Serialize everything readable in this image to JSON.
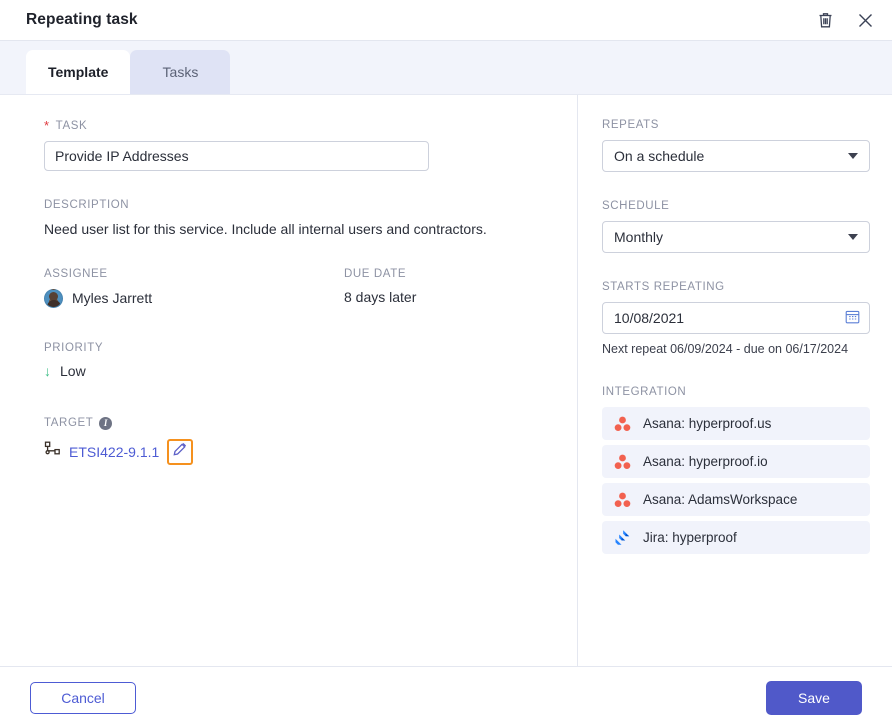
{
  "header": {
    "title": "Repeating task",
    "delete_icon": "trash-icon",
    "close_icon": "close-icon"
  },
  "tabs": [
    {
      "label": "Template",
      "active": true
    },
    {
      "label": "Tasks",
      "active": false
    }
  ],
  "form": {
    "task": {
      "label": "TASK",
      "required_marker": "*",
      "value": "Provide IP Addresses"
    },
    "description": {
      "label": "DESCRIPTION",
      "value": "Need user list for this service. Include all internal users and contractors."
    },
    "assignee": {
      "label": "ASSIGNEE",
      "value": "Myles Jarrett",
      "avatar_icon": "avatar"
    },
    "due_date": {
      "label": "DUE DATE",
      "value": "8 days later"
    },
    "priority": {
      "label": "PRIORITY",
      "value": "Low",
      "arrow_glyph": "↓",
      "arrow_color": "#3fbf87"
    },
    "target": {
      "label": "TARGET",
      "info_glyph": "i",
      "link_text": "ETSI422-9.1.1",
      "link_color": "#4d5bd4",
      "hierarchy_icon": "sitemap-icon",
      "edit_icon": "pencil-icon",
      "focus_color": "#f5911e"
    }
  },
  "schedule": {
    "repeats": {
      "label": "REPEATS",
      "value": "On a schedule"
    },
    "schedule": {
      "label": "SCHEDULE",
      "value": "Monthly"
    },
    "starts_repeating": {
      "label": "STARTS REPEATING",
      "value": "10/08/2021",
      "calendar_icon": "calendar-icon",
      "hint": "Next repeat 06/09/2024 - due on 06/17/2024"
    }
  },
  "integration": {
    "label": "INTEGRATION",
    "items": [
      {
        "label": "Asana: hyperproof.us",
        "icon": "asana-icon"
      },
      {
        "label": "Asana: hyperproof.io",
        "icon": "asana-icon"
      },
      {
        "label": "Asana: AdamsWorkspace",
        "icon": "asana-icon"
      },
      {
        "label": "Jira: hyperproof",
        "icon": "jira-icon"
      }
    ]
  },
  "footer": {
    "cancel_label": "Cancel",
    "save_label": "Save",
    "save_color": "#5059c9",
    "cancel_color": "#4d5bd4"
  }
}
